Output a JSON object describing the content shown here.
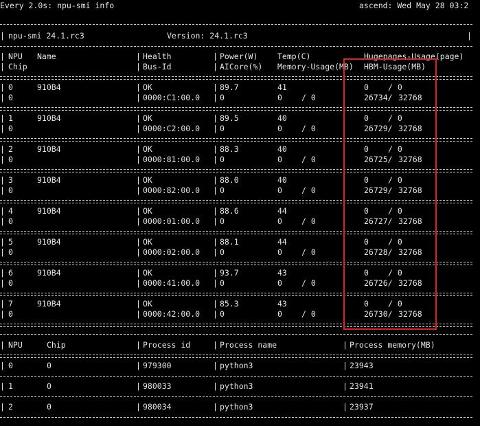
{
  "header": {
    "command": "Every 2.0s: npu-smi info",
    "host_time": "ascend: Wed May 28 03:2"
  },
  "info": {
    "tool": "npu-smi 24.1.rc3",
    "version": "Version: 24.1.rc3"
  },
  "columns": {
    "c1a": "NPU",
    "c1b": "Chip",
    "c2a": "Name",
    "c3a": "Health",
    "c3b": "Bus-Id",
    "c4a": "Power(W)",
    "c4b": "AICore(%)",
    "c5a": "Temp(C)",
    "c5b": "Memory-Usage(MB)",
    "c6a": "Hugepages-Usage(page)",
    "c6b": "HBM-Usage(MB)"
  },
  "devices": [
    {
      "npu": "0",
      "name": "910B4",
      "health": "OK",
      "power": "89.7",
      "temp": "41",
      "hp_used": "0",
      "hp_total": "/ 0",
      "chip": "0",
      "bus": "0000:C1:00.0",
      "aicore": "0",
      "mem_used": "0",
      "mem_total": "/ 0",
      "hbm_used": "26734/",
      "hbm_total": "32768"
    },
    {
      "npu": "1",
      "name": "910B4",
      "health": "OK",
      "power": "89.5",
      "temp": "40",
      "hp_used": "0",
      "hp_total": "/ 0",
      "chip": "0",
      "bus": "0000:C2:00.0",
      "aicore": "0",
      "mem_used": "0",
      "mem_total": "/ 0",
      "hbm_used": "26729/",
      "hbm_total": "32768"
    },
    {
      "npu": "2",
      "name": "910B4",
      "health": "OK",
      "power": "88.3",
      "temp": "40",
      "hp_used": "0",
      "hp_total": "/ 0",
      "chip": "0",
      "bus": "0000:81:00.0",
      "aicore": "0",
      "mem_used": "0",
      "mem_total": "/ 0",
      "hbm_used": "26725/",
      "hbm_total": "32768"
    },
    {
      "npu": "3",
      "name": "910B4",
      "health": "OK",
      "power": "88.0",
      "temp": "40",
      "hp_used": "0",
      "hp_total": "/ 0",
      "chip": "0",
      "bus": "0000:82:00.0",
      "aicore": "0",
      "mem_used": "0",
      "mem_total": "/ 0",
      "hbm_used": "26729/",
      "hbm_total": "32768"
    },
    {
      "npu": "4",
      "name": "910B4",
      "health": "OK",
      "power": "88.6",
      "temp": "44",
      "hp_used": "0",
      "hp_total": "/ 0",
      "chip": "0",
      "bus": "0000:01:00.0",
      "aicore": "0",
      "mem_used": "0",
      "mem_total": "/ 0",
      "hbm_used": "26727/",
      "hbm_total": "32768"
    },
    {
      "npu": "5",
      "name": "910B4",
      "health": "OK",
      "power": "88.1",
      "temp": "44",
      "hp_used": "0",
      "hp_total": "/ 0",
      "chip": "0",
      "bus": "0000:02:00.0",
      "aicore": "0",
      "mem_used": "0",
      "mem_total": "/ 0",
      "hbm_used": "26728/",
      "hbm_total": "32768"
    },
    {
      "npu": "6",
      "name": "910B4",
      "health": "OK",
      "power": "93.7",
      "temp": "43",
      "hp_used": "0",
      "hp_total": "/ 0",
      "chip": "0",
      "bus": "0000:41:00.0",
      "aicore": "0",
      "mem_used": "0",
      "mem_total": "/ 0",
      "hbm_used": "26726/",
      "hbm_total": "32768"
    },
    {
      "npu": "7",
      "name": "910B4",
      "health": "OK",
      "power": "85.3",
      "temp": "43",
      "hp_used": "0",
      "hp_total": "/ 0",
      "chip": "0",
      "bus": "0000:42:00.0",
      "aicore": "0",
      "mem_used": "0",
      "mem_total": "/ 0",
      "hbm_used": "26730/",
      "hbm_total": "32768"
    }
  ],
  "proc_columns": {
    "npu": "NPU",
    "chip": "Chip",
    "pid": "Process id",
    "pname": "Process name",
    "pmem": "Process memory(MB)"
  },
  "processes": [
    {
      "npu": "0",
      "chip": "0",
      "pid": "979300",
      "pname": "python3",
      "pmem": "23943"
    },
    {
      "npu": "1",
      "chip": "0",
      "pid": "980033",
      "pname": "python3",
      "pmem": "23941"
    },
    {
      "npu": "2",
      "chip": "0",
      "pid": "980034",
      "pname": "python3",
      "pmem": "23937"
    }
  ],
  "highlight_color": "#e02020"
}
